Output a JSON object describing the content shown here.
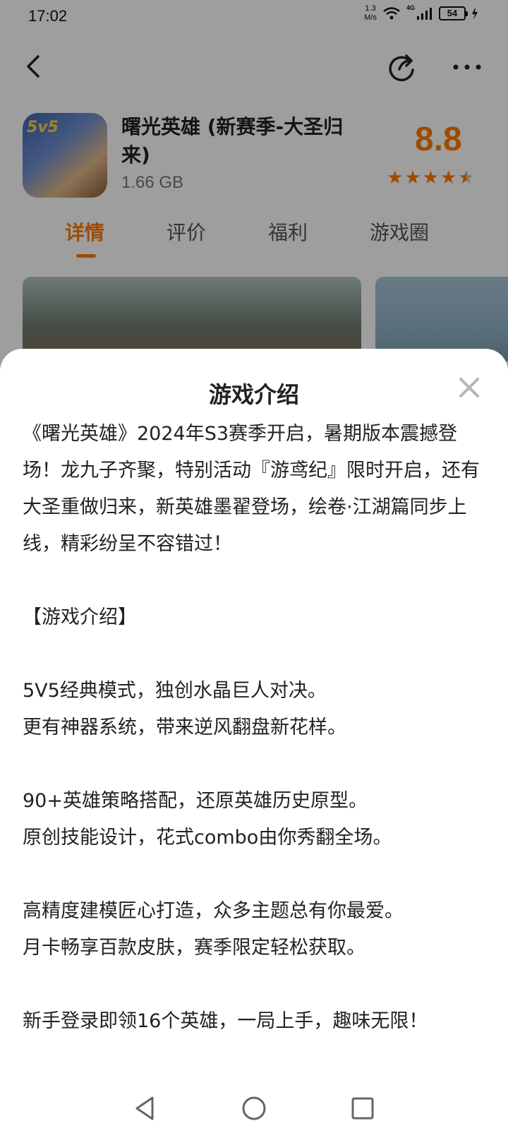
{
  "status_bar": {
    "time": "17:02",
    "net_speed_value": "1.3",
    "net_speed_unit": "M/s",
    "network_label": "4G",
    "battery": "54"
  },
  "app": {
    "icon_label": "5v5",
    "name": "曙光英雄 (新赛季-大圣归来)",
    "size": "1.66 GB",
    "rating": "8.8",
    "stars": 4.5,
    "accent_color": "#ff7a00"
  },
  "tabs": [
    {
      "label": "详情",
      "active": true
    },
    {
      "label": "评价",
      "active": false
    },
    {
      "label": "福利",
      "active": false
    },
    {
      "label": "游戏圈",
      "active": false
    }
  ],
  "sheet": {
    "title": "游戏介绍",
    "paragraphs": [
      "《曙光英雄》2024年S3赛季开启，暑期版本震撼登场！龙九子齐聚，特别活动『游鸢纪』限时开启，还有大圣重做归来，新英雄墨翟登场，绘卷·江湖篇同步上线，精彩纷呈不容错过！",
      "",
      "【游戏介绍】",
      "",
      "5V5经典模式，独创水晶巨人对决。",
      "更有神器系统，带来逆风翻盘新花样。",
      "",
      "90+英雄策略搭配，还原英雄历史原型。",
      "原创技能设计，花式combo由你秀翻全场。",
      "",
      "高精度建模匠心打造，众多主题总有你最爱。",
      "月卡畅享百款皮肤，赛季限定轻松获取。",
      "",
      "新手登录即领16个英雄，一局上手，趣味无限！"
    ]
  },
  "icons": {
    "back": "back-arrow-icon",
    "share": "share-icon",
    "more": "more-icon",
    "close": "close-icon",
    "nav_back": "triangle-back-icon",
    "nav_home": "circle-home-icon",
    "nav_recent": "square-recent-icon"
  }
}
